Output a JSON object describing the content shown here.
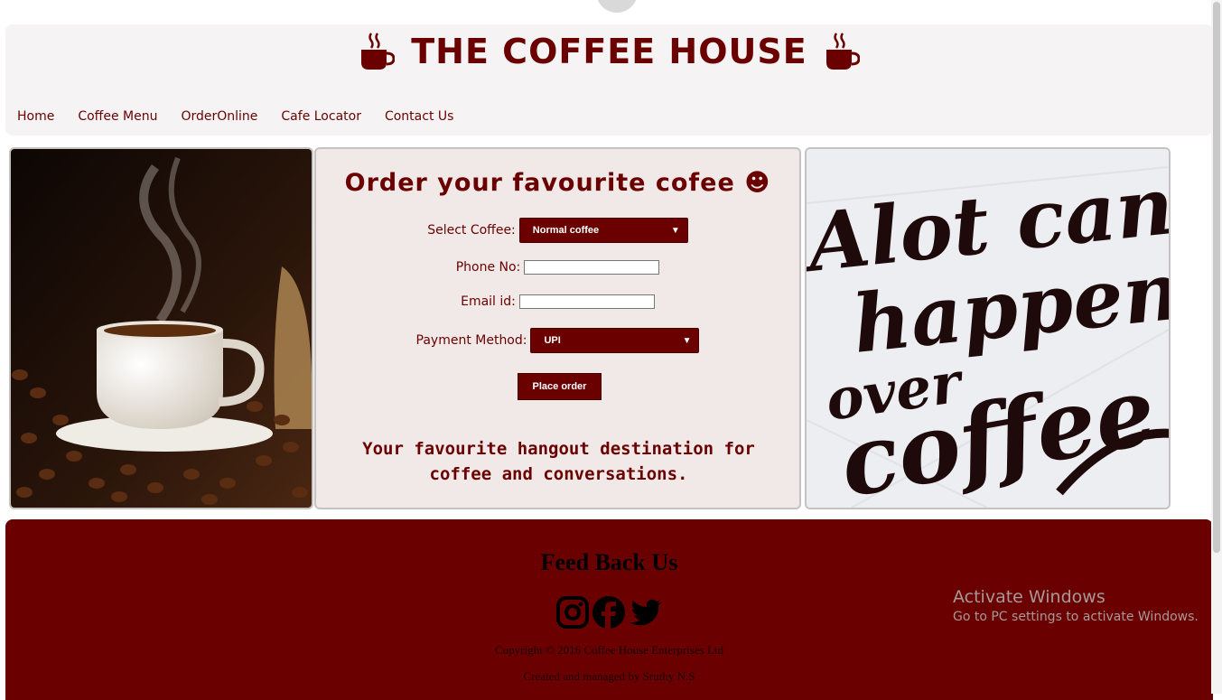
{
  "header": {
    "title": "THE COFFEE HOUSE"
  },
  "nav": {
    "items": [
      "Home",
      "Coffee Menu",
      "OrderOnline",
      "Cafe Locator",
      "Contact Us"
    ]
  },
  "order_form": {
    "title": "Order your favourite cofee ☻",
    "coffee_label": "Select Coffee:",
    "coffee_selected": "Normal coffee",
    "phone_label": "Phone No:",
    "phone_value": "",
    "email_label": "Email id:",
    "email_value": "",
    "payment_label": "Payment Method:",
    "payment_selected": "UPI",
    "submit_label": "Place order",
    "tagline": "Your favourite hangout destination for coffee and conversations."
  },
  "quote_image": {
    "lines": [
      "Alot can",
      "happen",
      "over",
      "coffee"
    ]
  },
  "footer": {
    "feedback_title": "Feed Back Us",
    "social_icons": [
      "instagram-icon",
      "facebook-icon",
      "twitter-icon"
    ],
    "copyright": "Copyright © 2016 Coffee House Enterprises Ltd",
    "created_by": "Created and managed by  Sruthy N.S"
  },
  "watermark": {
    "title": "Activate Windows",
    "subtitle": "Go to PC settings to activate Windows."
  },
  "colors": {
    "brand": "#6a0000",
    "header_bg": "#f5f3f4",
    "form_bg": "#f0e9e8"
  }
}
